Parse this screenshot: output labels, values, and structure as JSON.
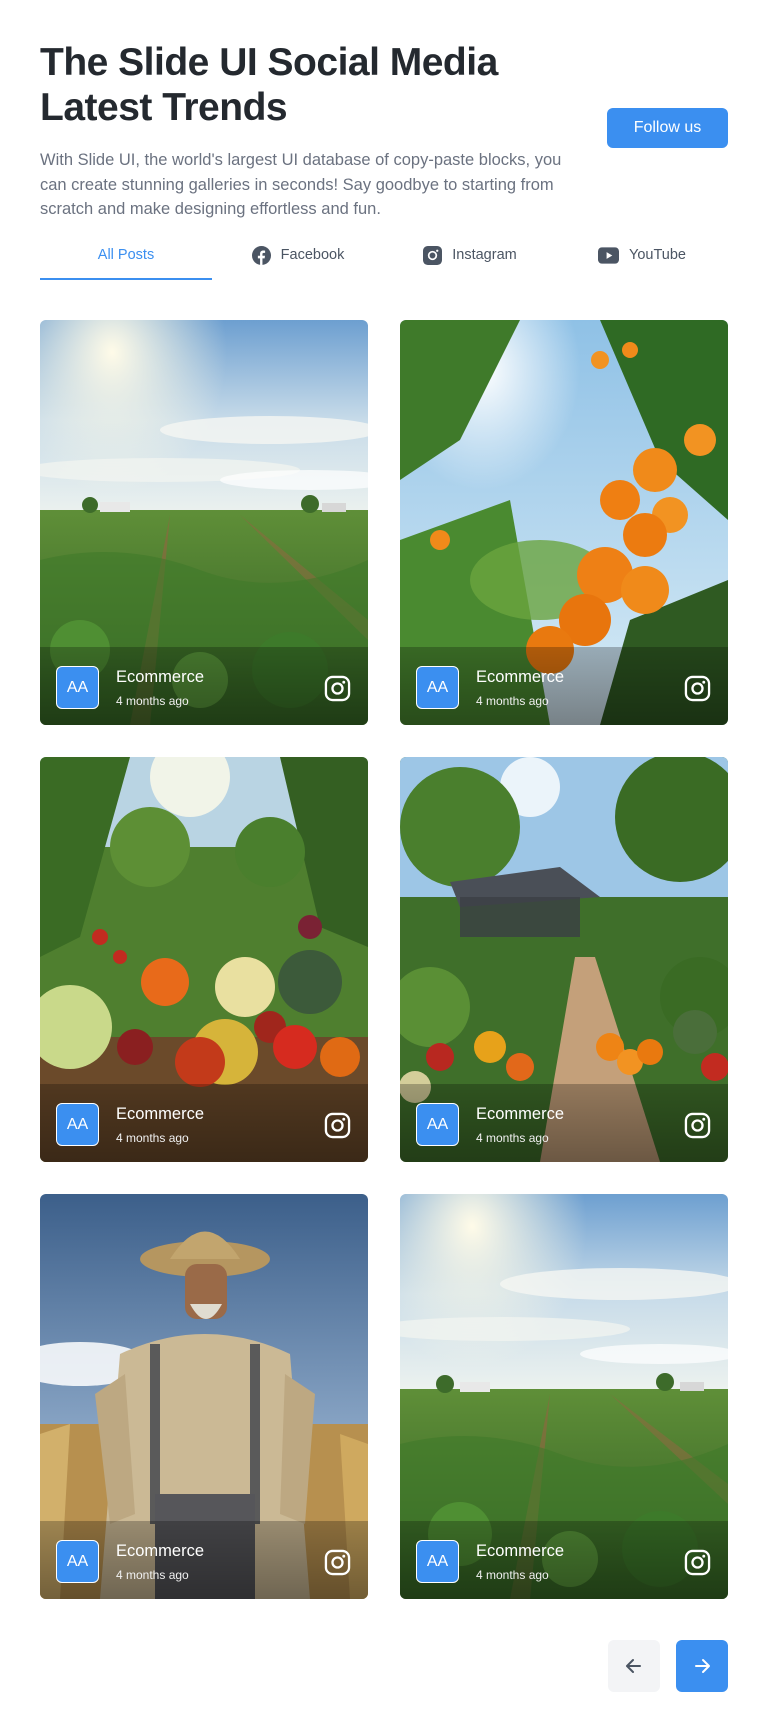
{
  "header": {
    "title": "The Slide UI Social Media Latest Trends",
    "description": "With Slide UI, the world's largest UI database of copy-paste blocks, you can create stunning galleries in seconds! Say goodbye to starting from scratch and make designing effortless and fun.",
    "follow_label": "Follow us"
  },
  "tabs": [
    {
      "label": "All Posts",
      "icon": "none",
      "active": true
    },
    {
      "label": "Facebook",
      "icon": "facebook-icon",
      "active": false
    },
    {
      "label": "Instagram",
      "icon": "instagram-icon",
      "active": false
    },
    {
      "label": "YouTube",
      "icon": "youtube-icon",
      "active": false
    }
  ],
  "posts": [
    {
      "avatar": "AA",
      "author": "Ecommerce",
      "time": "4 months ago",
      "image": "farm field with crop rows under sunny sky",
      "platform": "instagram-icon"
    },
    {
      "avatar": "AA",
      "author": "Ecommerce",
      "time": "4 months ago",
      "image": "orange tree with ripe oranges",
      "platform": "instagram-icon"
    },
    {
      "avatar": "AA",
      "author": "Ecommerce",
      "time": "4 months ago",
      "image": "pile of fresh vegetables in a garden",
      "platform": "instagram-icon"
    },
    {
      "avatar": "AA",
      "author": "Ecommerce",
      "time": "4 months ago",
      "image": "garden path with vegetables and greenhouse",
      "platform": "instagram-icon"
    },
    {
      "avatar": "AA",
      "author": "Ecommerce",
      "time": "4 months ago",
      "image": "farmer in straw hat in a wheat field",
      "platform": "instagram-icon"
    },
    {
      "avatar": "AA",
      "author": "Ecommerce",
      "time": "4 months ago",
      "image": "farm field with crop rows under sunny sky",
      "platform": "instagram-icon"
    }
  ],
  "pagination": {
    "prev_icon": "arrow-left-icon",
    "next_icon": "arrow-right-icon"
  },
  "colors": {
    "accent": "#3b8ff0",
    "text": "#24292f",
    "muted": "#6b7280"
  }
}
